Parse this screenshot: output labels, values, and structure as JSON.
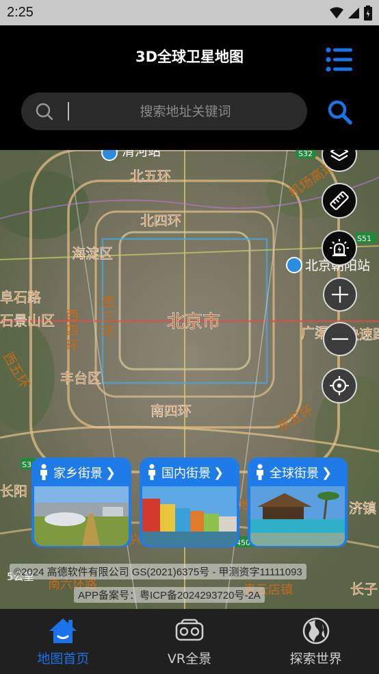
{
  "status_bar": {
    "time": "2:25"
  },
  "header": {
    "title": "3D全球卫星地图",
    "search_placeholder": "搜索地址关键词"
  },
  "street_view_cards": [
    {
      "label": "家乡街景"
    },
    {
      "label": "国内街景"
    },
    {
      "label": "全球街景"
    }
  ],
  "map_footer": {
    "copyright": "©2024 高德软件有限公司 GS(2021)6375号 - 甲测资字11111093",
    "icp": "APP备案号：粤ICP备2024293720号-2A"
  },
  "bottom_nav": [
    {
      "label": "地图首页",
      "active": true
    },
    {
      "label": "VR全景",
      "active": false
    },
    {
      "label": "探索世界",
      "active": false
    }
  ],
  "colors": {
    "accent": "#1a73e8",
    "card_blue": "#1f7be8",
    "header_bg": "#000000",
    "nav_bg": "#202020"
  },
  "icons": {
    "menu": "list-menu-icon",
    "search": "search-icon",
    "layers": "layers-icon",
    "ruler": "ruler-icon",
    "traffic": "alarm-light-icon",
    "zoom_in": "plus-icon",
    "zoom_out": "minus-icon",
    "locate": "crosshair-icon"
  }
}
